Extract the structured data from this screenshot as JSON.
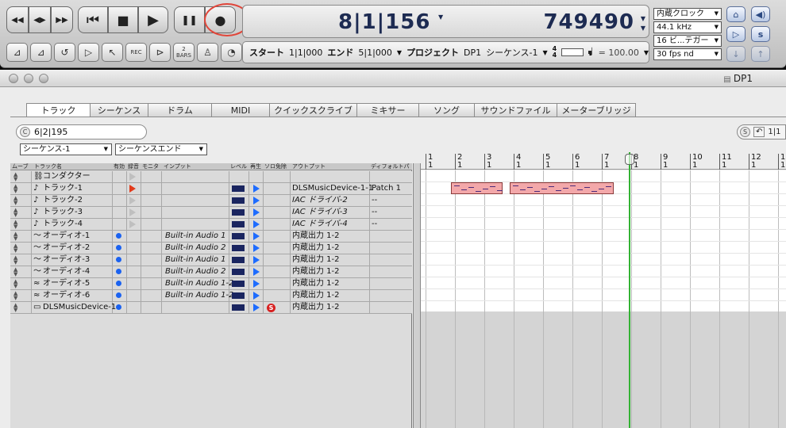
{
  "transport": {
    "rewind_fast": "◀◀",
    "rewind": "◀▶",
    "forward_fast": "▶▶",
    "skip_start": "⏮",
    "stop": "■",
    "play": "▶",
    "pause": "❚❚",
    "record": "●",
    "counter_bars": "8|1|156",
    "counter_samples": "749490",
    "small_buttons": [
      "",
      "",
      "",
      "",
      "",
      "REC",
      "",
      "2 BARS",
      "",
      ""
    ]
  },
  "infobar": {
    "start_label": "スタート",
    "start_value": "1|1|000",
    "end_label": "エンド",
    "end_value": "5|1|000",
    "project_label": "プロジェクト",
    "project_value": "DP1",
    "sequence": "シーケンス-1",
    "meter_top": "4",
    "meter_bottom": "4",
    "tempo": "= 100.00",
    "note_glyph": "♩",
    "tempo_position": 0.5
  },
  "selects": {
    "clock": "内蔵クロック",
    "rate": "44.1 kHz",
    "bits": "16 ビ...テガー",
    "fps": "30 fps nd"
  },
  "window": {
    "title": "DP1"
  },
  "tabs": [
    "トラック",
    "シーケンス",
    "ドラム",
    "MIDI",
    "クイックスクライブ",
    "ミキサー",
    "ソング",
    "サウンドファイル",
    "メーターブリッジ"
  ],
  "position": {
    "c_label": "C",
    "value": "6|2|195",
    "s_label": "S",
    "s_value": "1|1"
  },
  "popups": {
    "sequence": "シーケンス-1",
    "end": "シーケンスエンド"
  },
  "columns": {
    "move": "ムーブ",
    "name": "トラック名",
    "enable": "有効",
    "record": "録音",
    "monitor": "モニタ",
    "input": "インプット",
    "level": "レベル",
    "play": "再生",
    "solo": "ソロ免除",
    "output": "アウトプット",
    "default": "ディフォルトパ"
  },
  "tracks": [
    {
      "icon": "⛓",
      "name": "コンダクター",
      "input": "",
      "output": "",
      "default": "",
      "enabled": false,
      "rec": "off",
      "level": false,
      "play": false,
      "solo": false
    },
    {
      "icon": "♪",
      "name": "トラック-1",
      "input": "",
      "output": "DLSMusicDevice-1-1",
      "default": "Patch 1",
      "enabled": false,
      "rec": "on",
      "level": true,
      "play": true,
      "solo": false
    },
    {
      "icon": "♪",
      "name": "トラック-2",
      "input": "",
      "output": "IAC ドライバ-2",
      "default": "--",
      "enabled": false,
      "rec": "off",
      "level": true,
      "play": true,
      "solo": false
    },
    {
      "icon": "♪",
      "name": "トラック-3",
      "input": "",
      "output": "IAC ドライバ-3",
      "default": "--",
      "enabled": false,
      "rec": "off",
      "level": true,
      "play": true,
      "solo": false
    },
    {
      "icon": "♪",
      "name": "トラック-4",
      "input": "",
      "output": "IAC ドライバ-4",
      "default": "--",
      "enabled": false,
      "rec": "off",
      "level": true,
      "play": true,
      "solo": false
    },
    {
      "icon": "〜",
      "name": "オーディオ-1",
      "input": "Built-in Audio 1",
      "output": "内蔵出力 1-2",
      "default": "",
      "enabled": true,
      "rec": "none",
      "level": true,
      "play": true,
      "solo": false
    },
    {
      "icon": "〜",
      "name": "オーディオ-2",
      "input": "Built-in Audio 2",
      "output": "内蔵出力 1-2",
      "default": "",
      "enabled": true,
      "rec": "none",
      "level": true,
      "play": true,
      "solo": false
    },
    {
      "icon": "〜",
      "name": "オーディオ-3",
      "input": "Built-in Audio 1",
      "output": "内蔵出力 1-2",
      "default": "",
      "enabled": true,
      "rec": "none",
      "level": true,
      "play": true,
      "solo": false
    },
    {
      "icon": "〜",
      "name": "オーディオ-4",
      "input": "Built-in Audio 2",
      "output": "内蔵出力 1-2",
      "default": "",
      "enabled": true,
      "rec": "none",
      "level": true,
      "play": true,
      "solo": false
    },
    {
      "icon": "≈",
      "name": "オーディオ-5",
      "input": "Built-in Audio 1-2",
      "output": "内蔵出力 1-2",
      "default": "",
      "enabled": true,
      "rec": "none",
      "level": true,
      "play": true,
      "solo": false
    },
    {
      "icon": "≈",
      "name": "オーディオ-6",
      "input": "Built-in Audio 1-2",
      "output": "内蔵出力 1-2",
      "default": "",
      "enabled": true,
      "rec": "none",
      "level": true,
      "play": true,
      "solo": false
    },
    {
      "icon": "▭",
      "name": "DLSMusicDevice-1",
      "input": "",
      "output": "内蔵出力 1-2",
      "default": "",
      "enabled": true,
      "rec": "none",
      "level": true,
      "play": true,
      "solo": true
    }
  ],
  "solo_symbol": "S",
  "ruler": [
    "1",
    "2",
    "3",
    "4",
    "5",
    "6",
    "7",
    "8",
    "9",
    "10",
    "11",
    "12",
    "13"
  ],
  "ruler_sub": "1"
}
